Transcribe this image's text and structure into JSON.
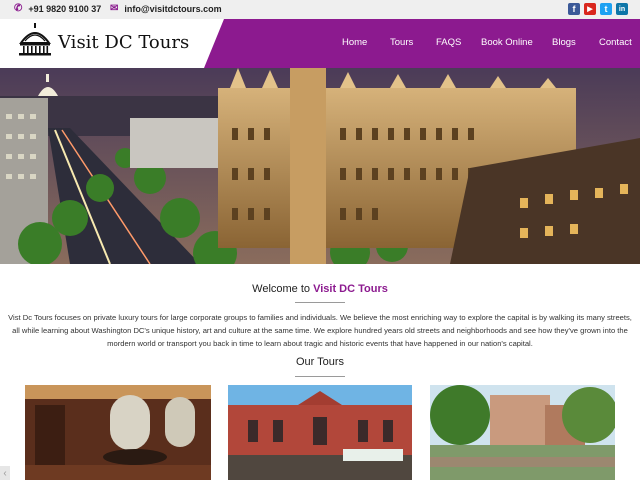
{
  "topbar": {
    "phone": "+91 9820 9100 37",
    "email": "info@visitdctours.com",
    "socials": [
      {
        "name": "facebook",
        "glyph": "f",
        "color": "#3b5998"
      },
      {
        "name": "youtube",
        "glyph": "▶",
        "color": "#d9261c"
      },
      {
        "name": "twitter",
        "glyph": "t",
        "color": "#1da1f2"
      },
      {
        "name": "linkedin",
        "glyph": "in",
        "color": "#0e76a8"
      }
    ]
  },
  "header": {
    "logo_text": "Visit DC Tours",
    "accent": "#8c1a8f",
    "nav": [
      "Home",
      "Tours",
      "FAQS",
      "Book Online",
      "Blogs",
      "Contact"
    ]
  },
  "welcome": {
    "lead": "Welcome to ",
    "brand": "Visit DC Tours",
    "intro": "Vist Dc Tours focuses on private luxury tours for large corporate groups to families and individuals. We believe the most enriching way to explore the capital is by walking its many streets, all while learning about Washington DC's unique history, art and culture at the same time. We explore hundred years old streets and neighborhoods and see how they've grown into the mordern world or transport you back in time to learn about tragic and historic events that have happened in our nation's capital."
  },
  "tours": {
    "title": "Our Tours"
  }
}
